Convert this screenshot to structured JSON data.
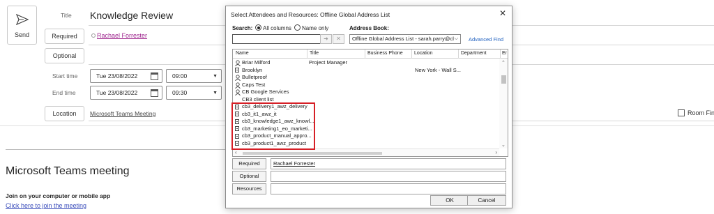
{
  "compose": {
    "send_label": "Send",
    "title_label": "Title",
    "title_value": "Knowledge Review",
    "required_label": "Required",
    "required_attendee": "Rachael Forrester",
    "optional_label": "Optional",
    "start_label": "Start time",
    "start_date": "Tue 23/08/2022",
    "start_time": "09:00",
    "end_label": "End time",
    "end_date": "Tue 23/08/2022",
    "end_time": "09:30",
    "location_label": "Location",
    "location_value": "Microsoft Teams Meeting",
    "room_finder": "Room Fin"
  },
  "body": {
    "heading": "Microsoft Teams meeting",
    "join_text": "Join on your computer or mobile app",
    "join_link": "Click here to join the meeting"
  },
  "dialog": {
    "title": "Select Attendees and Resources: Offline Global Address List",
    "close": "✕",
    "search_label": "Search:",
    "radio_all": "All columns",
    "radio_name": "Name only",
    "address_book_label": "Address Book:",
    "address_book_value": "Offline Global Address List - sarah.parry@cl",
    "advanced_find": "Advanced Find",
    "go_arrow": "➜",
    "clear_x": "✕",
    "columns": [
      "Name",
      "Title",
      "Business Phone",
      "Location",
      "Department",
      "Er"
    ],
    "rows": [
      {
        "icon": "person",
        "name": "Briar Milford",
        "title": "Project Manager",
        "location": ""
      },
      {
        "icon": "list",
        "name": "Brooklyn",
        "title": "",
        "location": "New York - Wall S..."
      },
      {
        "icon": "person",
        "name": "Bulletproof",
        "title": "",
        "location": ""
      },
      {
        "icon": "person",
        "name": "Caps Test",
        "title": "",
        "location": ""
      },
      {
        "icon": "person",
        "name": "CB Google Services",
        "title": "",
        "location": ""
      },
      {
        "icon": "none",
        "name": "CB3 client list",
        "title": "",
        "location": ""
      },
      {
        "icon": "list",
        "name": "cb3_delivery1_awz_delivery",
        "title": "",
        "location": ""
      },
      {
        "icon": "list",
        "name": "cb3_it1_awz_it",
        "title": "",
        "location": ""
      },
      {
        "icon": "list",
        "name": "cb3_knowledge1_awz_knowl...",
        "title": "",
        "location": ""
      },
      {
        "icon": "list",
        "name": "cb3_marketing1_eo_marketi...",
        "title": "",
        "location": ""
      },
      {
        "icon": "list",
        "name": "cb3_product_manual_appro...",
        "title": "",
        "location": ""
      },
      {
        "icon": "list",
        "name": "cb3_product1_awz_product",
        "title": "",
        "location": ""
      }
    ],
    "required_btn": "Required",
    "required_value": "Rachael Forrester",
    "optional_btn": "Optional",
    "resources_btn": "Resources",
    "ok": "OK",
    "cancel": "Cancel"
  },
  "colors": {
    "highlight": "#d61f26",
    "link": "#3a4dbb",
    "attendee_link": "#a0288f"
  }
}
